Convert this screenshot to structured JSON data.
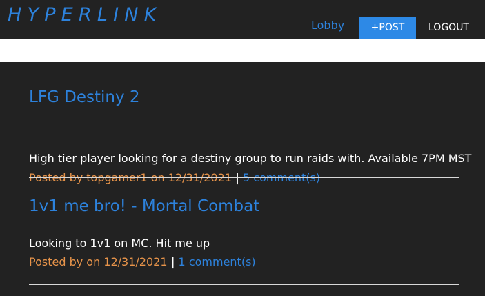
{
  "header": {
    "brand": "HYPERLINK",
    "nav": {
      "lobby_label": "Lobby",
      "post_label": "+POST",
      "logout_label": "LOGOUT"
    }
  },
  "posts": [
    {
      "title": "LFG Destiny 2",
      "body": "High tier player looking for a destiny group to run raids with. Available 7PM MST",
      "meta_by": "Posted by topgamer1 on 12/31/2021",
      "separator": "|",
      "comments": "5 comment(s)"
    },
    {
      "title": "1v1 me bro! - Mortal Combat",
      "body": "Looking to 1v1 on MC. Hit me up",
      "meta_by": "Posted by on 12/31/2021",
      "separator": "|",
      "comments": "1 comment(s)"
    }
  ],
  "colors": {
    "background": "#222222",
    "accent_blue": "#2d82dc",
    "button_blue": "#2d89e6",
    "meta_orange": "#e8944a",
    "text": "#ffffff"
  }
}
